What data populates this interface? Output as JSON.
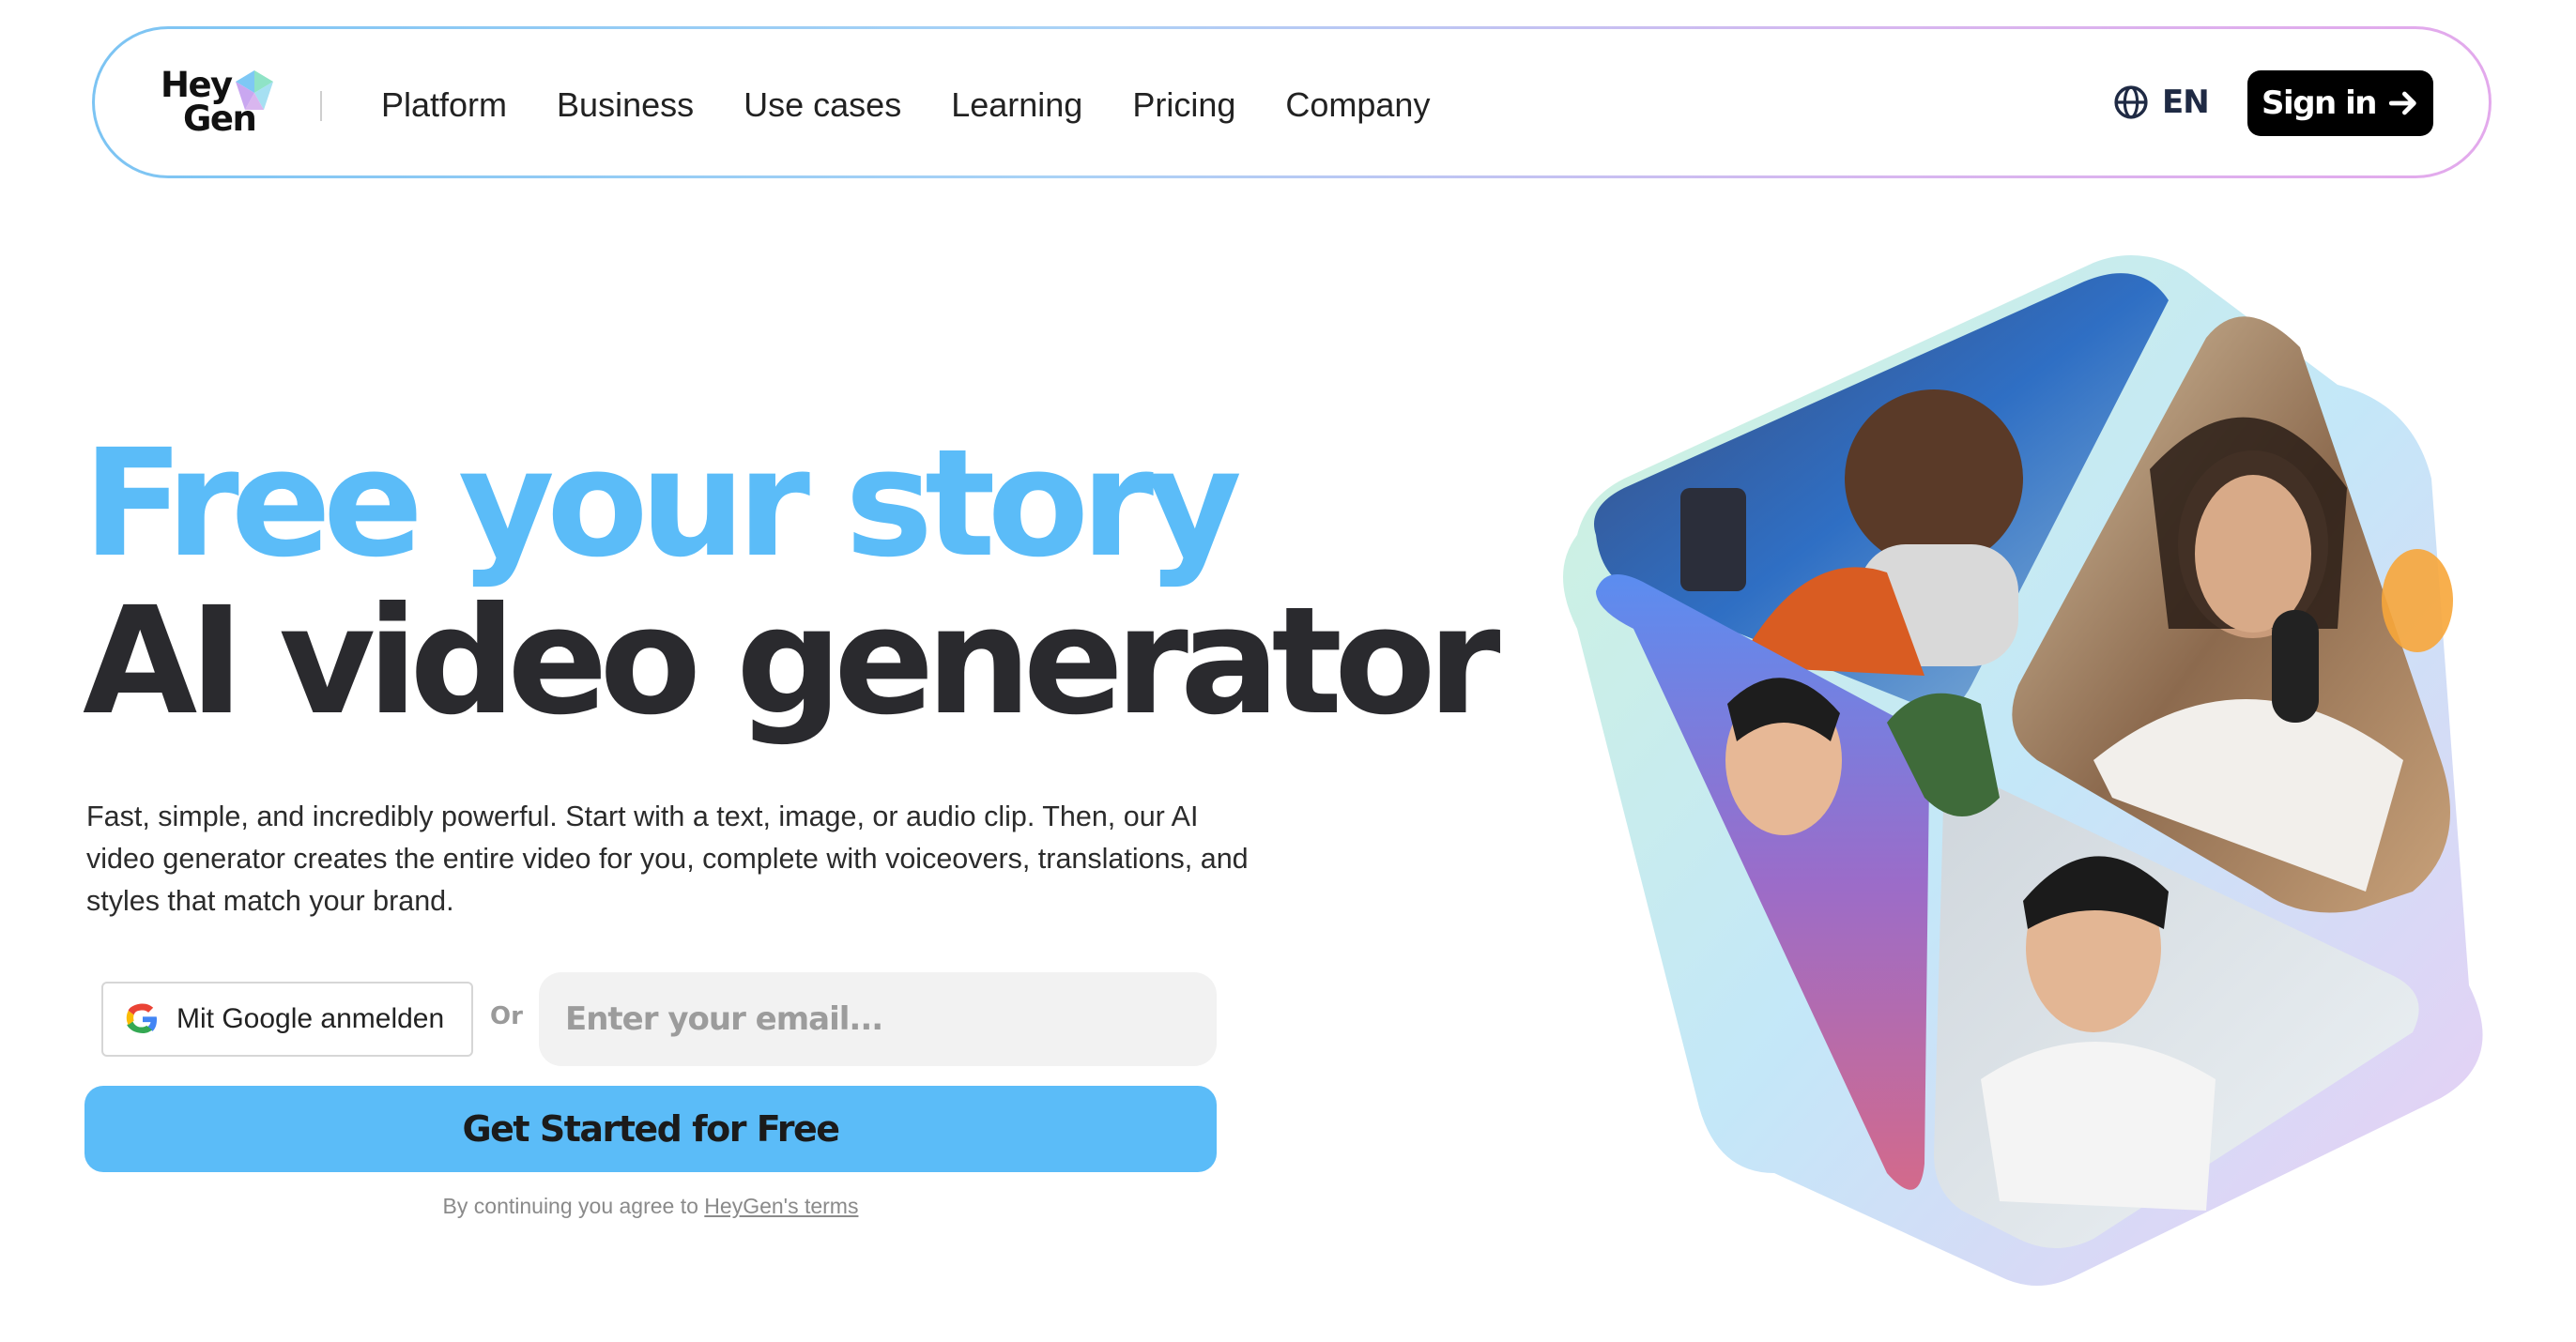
{
  "nav": {
    "logo": {
      "line1": "Hey",
      "line2": "Gen"
    },
    "links": [
      "Platform",
      "Business",
      "Use cases",
      "Learning",
      "Pricing",
      "Company"
    ],
    "language": {
      "icon": "globe-icon",
      "label": "EN"
    },
    "signin": {
      "label": "Sign in",
      "icon": "arrow-right-icon"
    }
  },
  "hero": {
    "headline_line1": "Free your story",
    "headline_line2": "AI video generator",
    "description": "Fast, simple, and incredibly powerful. Start with a text, image, or audio clip. Then, our AI video generator creates the entire video for you, complete with voiceovers, translations, and styles that match your brand."
  },
  "form": {
    "google_button": {
      "label": "Mit Google anmelden",
      "icon": "google-icon"
    },
    "or_label": "Or",
    "email": {
      "placeholder": "Enter your email...",
      "value": ""
    },
    "cta_label": "Get Started for Free",
    "terms_prefix": "By continuing you agree to",
    "terms_link": "HeyGen's terms"
  },
  "colors": {
    "accent": "#5bbcf8",
    "headline_dark": "#2a2a2e",
    "signin_bg": "#000000",
    "nav_border_start": "#7cc4f3",
    "nav_border_end": "#e3a9ec"
  }
}
